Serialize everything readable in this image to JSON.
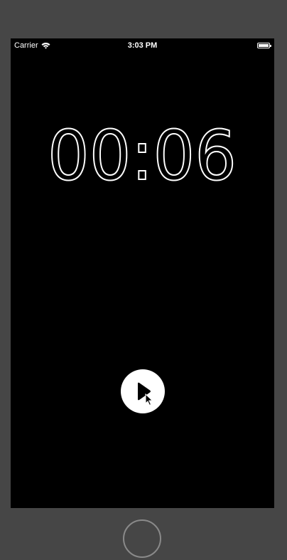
{
  "status_bar": {
    "carrier": "Carrier",
    "time": "3:03 PM",
    "battery_level": 1.0,
    "wifi_icon": "wifi-icon",
    "battery_icon": "battery-icon"
  },
  "timer": {
    "display": "00:06"
  },
  "controls": {
    "play_icon": "play-icon",
    "cursor_icon": "mouse-pointer-icon"
  },
  "device": {
    "home_button": "home-button"
  },
  "colors": {
    "screen_background": "#000000",
    "device_frame": "#464646",
    "foreground": "#ffffff"
  }
}
